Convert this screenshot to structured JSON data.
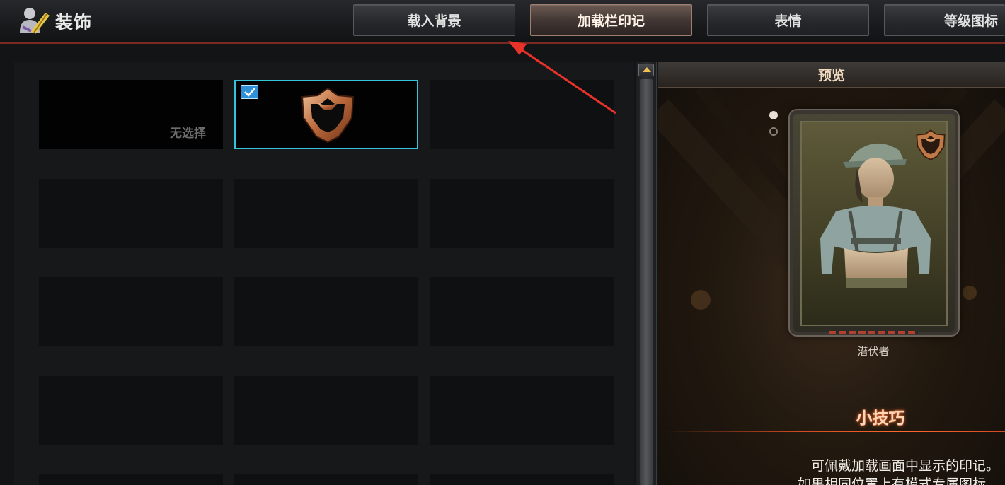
{
  "header": {
    "title": "装饰",
    "title_icon": "decoration-person-icon",
    "tabs": [
      {
        "label": "载入背景",
        "active": false
      },
      {
        "label": "加载栏印记",
        "active": true
      },
      {
        "label": "表情",
        "active": false
      },
      {
        "label": "等级图标",
        "active": false
      }
    ]
  },
  "grid": {
    "none_label": "无选择",
    "selected_index": 1,
    "selected_icon": "bronze-emblem-icon",
    "check_icon": "checkmark-icon"
  },
  "scrollbar": {
    "up_icon": "scroll-up-arrow-icon"
  },
  "preview": {
    "title": "预览",
    "character_name": "潜伏者",
    "tips_title": "小技巧",
    "tips_lines": [
      "可佩戴加载画面中显示的印记。",
      "如果相同位置上有模式专属图标，"
    ]
  },
  "colors": {
    "selection_border": "#36c4dc",
    "active_tab": "#6b5a52",
    "accent_red": "#d24a22",
    "arrow_red": "#e8322a"
  }
}
